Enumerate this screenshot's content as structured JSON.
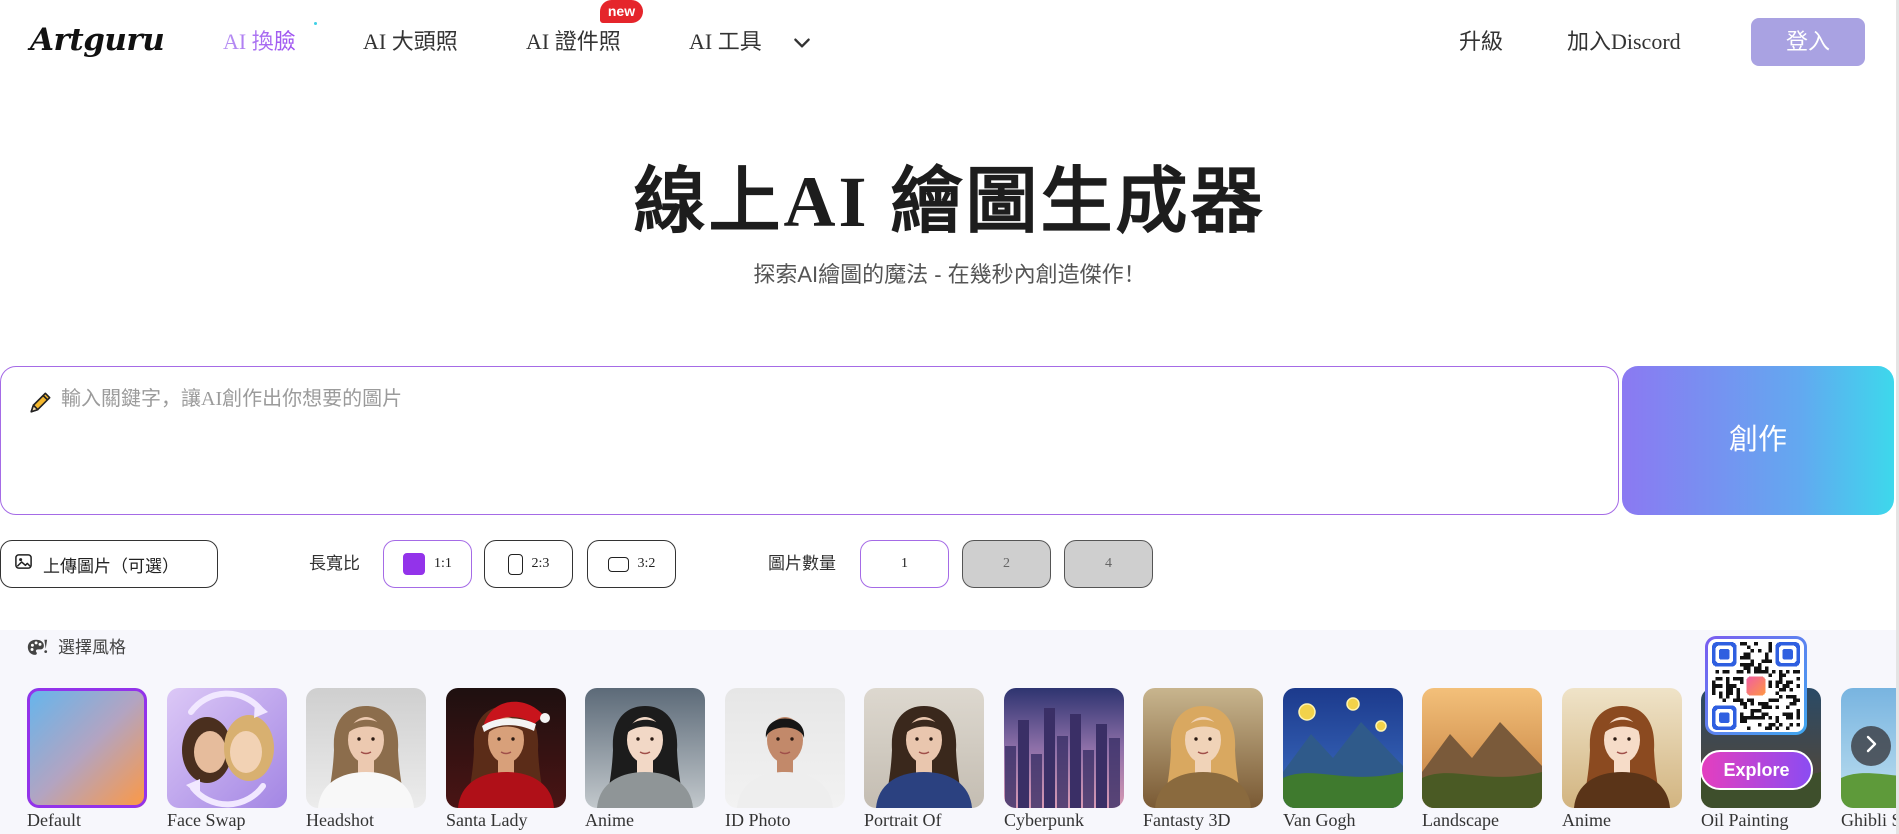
{
  "header": {
    "logo": "Artguru",
    "nav": [
      {
        "label": "AI 換臉",
        "active": true
      },
      {
        "label": "AI 大頭照"
      },
      {
        "label": "AI 證件照",
        "badge": "new"
      },
      {
        "label": "AI 工具"
      }
    ],
    "upgrade": "升級",
    "discord": "加入Discord",
    "login": "登入"
  },
  "hero": {
    "title": "線上AI 繪圖生成器",
    "subtitle": "探索AI繪圖的魔法 - 在幾秒內創造傑作！"
  },
  "prompt": {
    "placeholder": "輸入關鍵字，讓AI創作出你想要的圖片",
    "create": "創作"
  },
  "options": {
    "upload": "上傳圖片（可選）",
    "ratio_label": "長寬比",
    "ratios": [
      {
        "label": "1:1",
        "selected": true
      },
      {
        "label": "2:3"
      },
      {
        "label": "3:2"
      }
    ],
    "count_label": "圖片數量",
    "counts": [
      {
        "label": "1",
        "selected": true,
        "available": true
      },
      {
        "label": "2",
        "available": false
      },
      {
        "label": "4",
        "available": false
      }
    ]
  },
  "styles": {
    "heading": "選擇風格",
    "items": [
      {
        "label": "Default",
        "selected": true,
        "bg": [
          "#62b6ee",
          "#b2a4c2",
          "#ff9840"
        ]
      },
      {
        "label": "Face Swap",
        "bg": [
          "#dcc8f6",
          "#a386e4"
        ],
        "faces": [
          "#e6bc9c",
          "#f2d2b4"
        ],
        "hair": [
          "#4a2f1e",
          "#d8b070"
        ],
        "arrows": "#f1e8ff"
      },
      {
        "label": "Headshot",
        "bg": [
          "#cfcfcf",
          "#ececec"
        ],
        "hair": "#8c6d4c",
        "skin": "#ecc9b0",
        "top": "#f8f8f8"
      },
      {
        "label": "Santa Lady",
        "bg": [
          "#1e1010",
          "#4a1414"
        ],
        "hair": "#5b2c18",
        "skin": "#d8a07a",
        "top": "#b01018",
        "hat": "#c8141c"
      },
      {
        "label": "Anime",
        "bg": [
          "#5c6a78",
          "#c2c8cc"
        ],
        "hair": "#1c1c1c",
        "skin": "#f2d8c6",
        "top": "#8f9597"
      },
      {
        "label": "ID Photo",
        "bg": [
          "#e6e6e6",
          "#f2f2f2"
        ],
        "hair": "#161616",
        "skin": "#c2896a",
        "top": "#eeeeee",
        "short_hair": true
      },
      {
        "label": "Portrait Of",
        "bg": [
          "#ddd8cf",
          "#c4bdb2"
        ],
        "hair": "#3a281c",
        "skin": "#e9c6ae",
        "top": "#2b4180"
      },
      {
        "label": "Cyberpunk",
        "bg": [
          "#2e3470",
          "#8d6fa8",
          "#d99ab4"
        ],
        "buildings": "#3a2f66"
      },
      {
        "label": "Fantasty 3D",
        "bg": [
          "#c8b58e",
          "#7a5a34"
        ],
        "hair": "#d9a860",
        "skin": "#f0d3b8",
        "top": "#8a6a3e"
      },
      {
        "label": "Van Gogh",
        "bg": [
          "#1c3a8c",
          "#3d6fc4"
        ],
        "stars": "#f2d24a",
        "mountain": "#2f5a8a",
        "ground": "#3f7a2e"
      },
      {
        "label": "Landscape",
        "bg": [
          "#f3c07a",
          "#c07a3a"
        ],
        "mountain": "#7a5a3a",
        "ground": "#4a5a24"
      },
      {
        "label": "Anime",
        "bg": [
          "#efe3c8",
          "#d2b480"
        ],
        "hair": "#8b4a20",
        "skin": "#f6dcc8",
        "top": "#5a3418"
      },
      {
        "label": "Oil Painting",
        "bg": [
          "#2a4a66",
          "#5b4630"
        ],
        "ground": "#3e4f2c"
      },
      {
        "label": "Ghibli S",
        "bg": [
          "#78b4e0",
          "#bfe0f0"
        ],
        "ground": "#5e9a3a"
      }
    ]
  },
  "promo": {
    "explore": "Explore"
  },
  "colors": {
    "accent": "#a56be6",
    "selected_border": "#9333ea",
    "badge": "#e5252b",
    "login_bg": "#a9a2e2",
    "create_from": "#8b79f2",
    "create_to": "#3dd8ec",
    "disabled_bg": "#cfcfcf",
    "explore_from": "#e43fbf",
    "explore_to": "#8b4cf2",
    "qr_finder": "#2f5fe0"
  }
}
